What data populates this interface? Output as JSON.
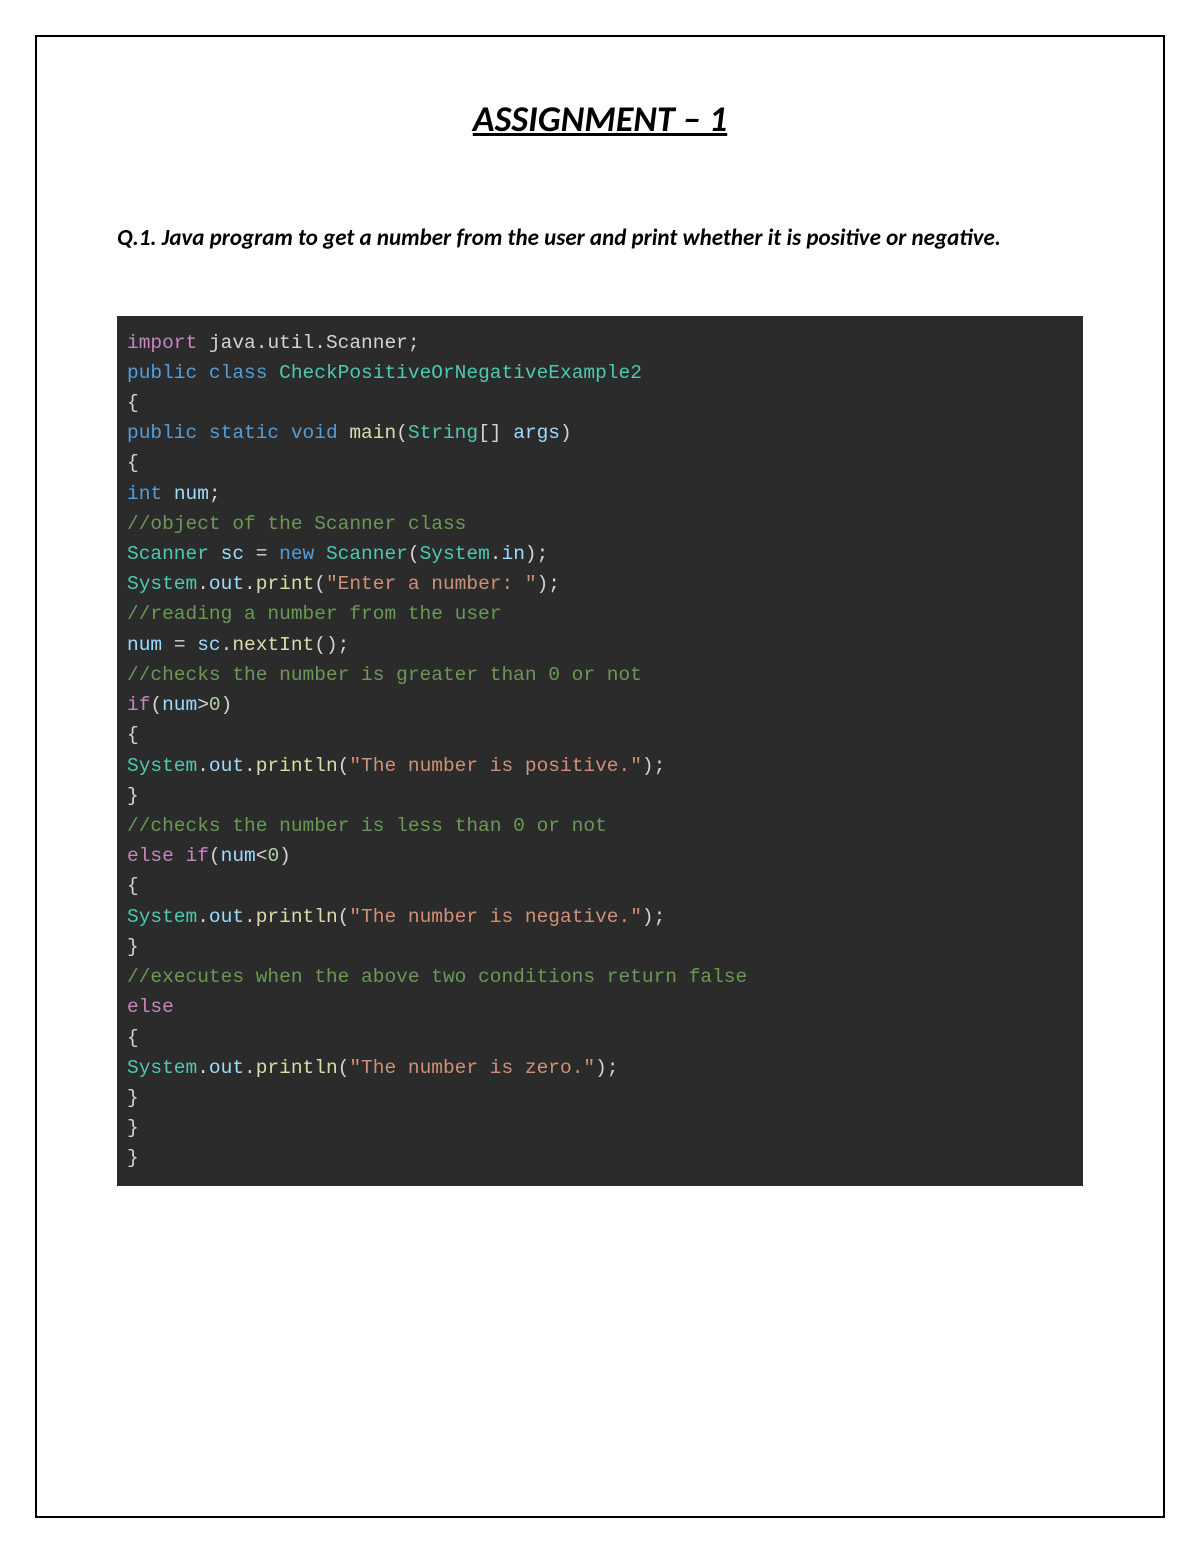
{
  "title": "ASSIGNMENT – 1",
  "question": "Q.1. Java program to get a number from the user and print whether it is positive or negative.",
  "code": {
    "l1_kw1": "import",
    "l1_txt1": " java",
    "l1_txt2": "util",
    "l1_txt3": "Scanner",
    "l2_kw1": "public",
    "l2_kw2": "class",
    "l2_cls": "CheckPositiveOrNegativeExample2",
    "l3": "{",
    "l4_kw1": "public",
    "l4_kw2": "static",
    "l4_kw3": "void",
    "l4_fn": "main",
    "l4_type": "String",
    "l4_var": "args",
    "l5": "{",
    "l6_kw": "int",
    "l6_var": "num",
    "l7": "//object of the Scanner class",
    "l8_type1": "Scanner",
    "l8_var": "sc",
    "l8_kw": "new",
    "l8_type2": "Scanner",
    "l8_sys": "System",
    "l8_in": "in",
    "l9_sys": "System",
    "l9_out": "out",
    "l9_fn": "print",
    "l9_str": "\"Enter a number: \"",
    "l10": "//reading a number from the user",
    "l11_var1": "num",
    "l11_var2": "sc",
    "l11_fn": "nextInt",
    "l12": "//checks the number is greater than 0 or not",
    "l13_kw": "if",
    "l13_var": "num",
    "l13_num": "0",
    "l14": "{",
    "l15_sys": "System",
    "l15_out": "out",
    "l15_fn": "println",
    "l15_str": "\"The number is positive.\"",
    "l16": "}",
    "l17": "//checks the number is less than 0 or not",
    "l18_kw1": "else",
    "l18_kw2": "if",
    "l18_var": "num",
    "l18_num": "0",
    "l19": "{",
    "l20_sys": "System",
    "l20_out": "out",
    "l20_fn": "println",
    "l20_str": "\"The number is negative.\"",
    "l21": "}",
    "l22": "//executes when the above two conditions return false",
    "l23_kw": "else",
    "l24": "{",
    "l25_sys": "System",
    "l25_out": "out",
    "l25_fn": "println",
    "l25_str": "\"The number is zero.\"",
    "l26": "}",
    "l27": "}",
    "l28": "}"
  }
}
